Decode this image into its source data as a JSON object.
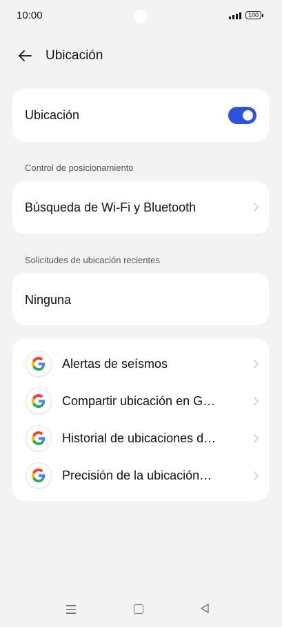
{
  "status": {
    "time": "10:00",
    "battery": "100"
  },
  "header": {
    "title": "Ubicación"
  },
  "location": {
    "label": "Ubicación",
    "toggle_on": true,
    "toggle_color": "#2F52E0"
  },
  "positioning": {
    "section_title": "Control de posicionamiento",
    "item_label": "Búsqueda de Wi-Fi y Bluetooth"
  },
  "recent": {
    "section_title": "Solicitudes de ubicación recientes",
    "none_label": "Ninguna"
  },
  "google_items": [
    {
      "label": "Alertas de seísmos",
      "icon": "google-icon"
    },
    {
      "label": "Compartir ubicación en G…",
      "icon": "google-icon"
    },
    {
      "label": "Historial de ubicaciones d…",
      "icon": "google-icon"
    },
    {
      "label": "Precisión de la ubicación…",
      "icon": "google-icon"
    }
  ],
  "navigation": {
    "icons": [
      "menu-icon",
      "home-icon",
      "back-icon"
    ]
  }
}
